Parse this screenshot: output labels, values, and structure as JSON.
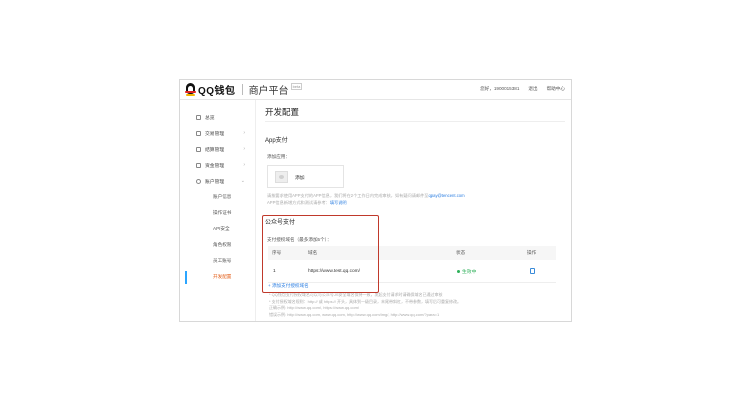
{
  "header": {
    "logo_text": "QQ钱包",
    "platform": "商户平台",
    "badge": "beta",
    "greeting": "您好，1900015381",
    "logout": "退出",
    "help": "帮助中心"
  },
  "sidebar": {
    "items": [
      {
        "label": "总览",
        "icon": "home-icon"
      },
      {
        "label": "交易管理",
        "icon": "transaction-icon"
      },
      {
        "label": "结算管理",
        "icon": "settlement-icon"
      },
      {
        "label": "资金管理",
        "icon": "funds-icon"
      },
      {
        "label": "账户管理",
        "icon": "account-icon"
      }
    ],
    "sub_items": [
      {
        "label": "账户信息"
      },
      {
        "label": "操作证书"
      },
      {
        "label": "API安全"
      },
      {
        "label": "角色权限"
      },
      {
        "label": "员工账号"
      },
      {
        "label": "开发配置"
      }
    ]
  },
  "main": {
    "title": "开发配置",
    "app_pay": {
      "title": "App支付",
      "add_app_label": "添加应用：",
      "add_button": "添加",
      "note_line1_prefix": "请按要求使用APP支付的APP信息，我们将在2个工作日内完成审核，如有疑问请邮件至",
      "note_email": "qpay@tencent.com",
      "note_line2_prefix": "APP信息新增方式和测试请参考：",
      "note_link": "填写说明"
    },
    "official_pay": {
      "title": "公众号支付",
      "domain_label": "支付授权域名（最多添加5个）：",
      "table": {
        "headers": [
          "序号",
          "域名",
          "状态",
          "操作"
        ],
        "rows": [
          {
            "index": "1",
            "domain": "https://www.test.qq.com/",
            "status": "生效中"
          }
        ]
      },
      "add_domain_link": "+ 添加支付授权域名",
      "notes": [
        "* QQ钱包支付授权域名可以与公众号JS安全域名保持一致，发起支付请求时请确保域名已通过审核",
        "* 支付授权域名规则：http:// 或 https:// 开头，具体到一级目录，末尾带斜杠，不带参数，填写后可重复修改。",
        "正确示例: http://www.qq.com/, https://www.qq.com/",
        "错误示例: http://www.qq.com, www.qq.com, http://www.qq.com/img/, http://www.qq.com/?para=1"
      ]
    }
  },
  "colors": {
    "accent_orange": "#e35d16",
    "active_bar": "#2ba5ff",
    "highlight_box": "#c0392b",
    "status_green": "#2eb05a",
    "link_blue": "#2a7de1"
  }
}
